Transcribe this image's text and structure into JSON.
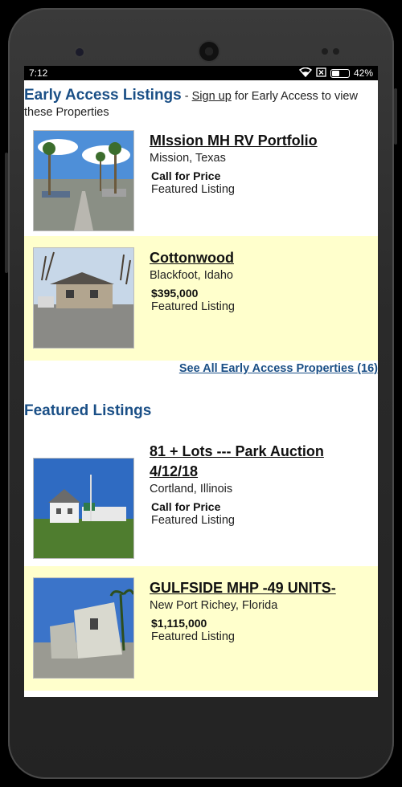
{
  "status": {
    "time": "7:12",
    "battery": "42%",
    "battery_level": 0.42
  },
  "early_access": {
    "title": "Early Access Listings",
    "sep": " - ",
    "signup": "Sign up",
    "rest": " for Early Access to view these Properties"
  },
  "listings": [
    {
      "title": "MIssion MH RV Portfolio",
      "location": "Mission, Texas",
      "price": "Call for Price",
      "tag": "Featured Listing"
    },
    {
      "title": "Cottonwood",
      "location": "Blackfoot, Idaho",
      "price": "$395,000",
      "tag": "Featured Listing"
    }
  ],
  "see_all": "See All Early Access Properties (16)",
  "featured": {
    "title": "Featured Listings",
    "items": [
      {
        "title": "81 + Lots --- Park Auction 4/12/18",
        "location": "Cortland, Illinois",
        "price": "Call for Price",
        "tag": "Featured Listing"
      },
      {
        "title": "GULFSIDE MHP -49 UNITS-",
        "location": "New Port Richey, Florida",
        "price": "$1,115,000",
        "tag": "Featured Listing"
      }
    ]
  }
}
